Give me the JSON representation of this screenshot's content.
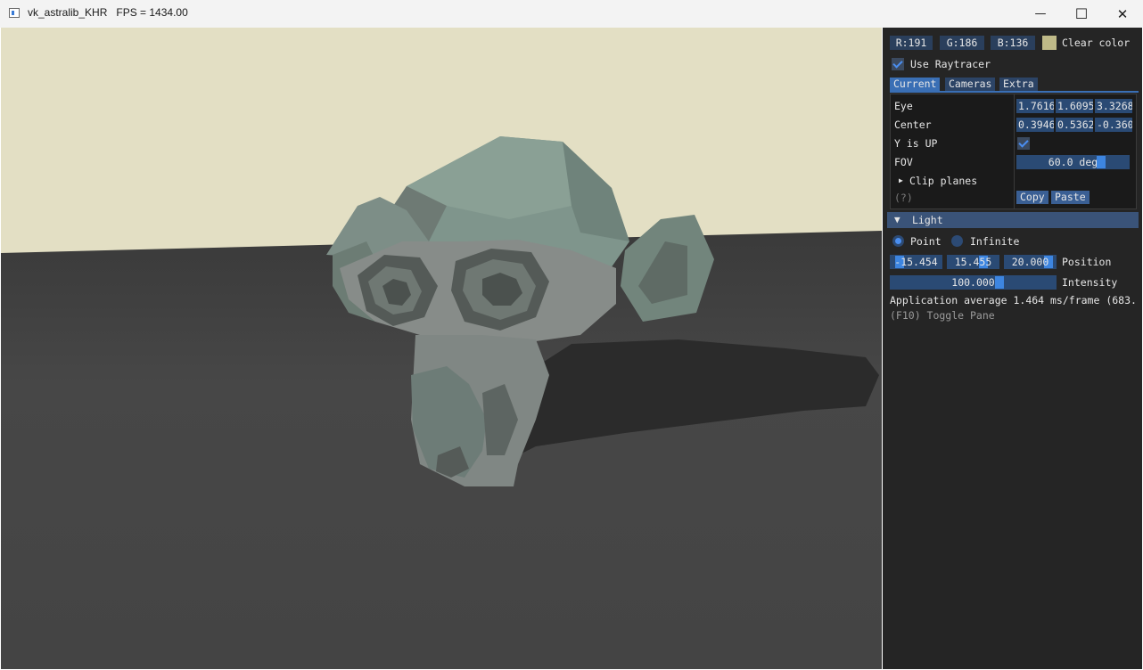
{
  "window": {
    "title": "vk_astralib_KHR   FPS = 1434.00",
    "minimize_glyph": "—",
    "maximize_glyph": "☐",
    "close_glyph": "✕"
  },
  "scene": {
    "sky_color": "#e3dfc4",
    "floor_color": "#464646",
    "mesh_name": "monkey"
  },
  "panel": {
    "clear_color": {
      "r_label": "R:191",
      "g_label": "G:186",
      "b_label": "B:136",
      "swatch": "#bfba88",
      "label": "Clear color"
    },
    "use_raytracer": {
      "label": "Use Raytracer",
      "checked": true
    },
    "tabs": [
      "Current",
      "Cameras",
      "Extra"
    ],
    "camera": {
      "eye_label": "Eye",
      "eye": [
        "1.7616",
        "1.6095",
        "3.3268"
      ],
      "center_label": "Center",
      "center": [
        "0.3946",
        "0.5362",
        "-0.360"
      ],
      "y_up_label": "Y is UP",
      "y_up": true,
      "fov_label": "FOV",
      "fov_value": "60.0 deg",
      "clip_label": "Clip planes",
      "help": "(?)",
      "copy_label": "Copy",
      "paste_label": "Paste"
    },
    "light": {
      "header": "Light",
      "point_label": "Point",
      "infinite_label": "Infinite",
      "selected": "Point",
      "position": [
        "-15.454",
        "15.455",
        "20.000"
      ],
      "position_label": "Position",
      "intensity": "100.000",
      "intensity_label": "Intensity"
    },
    "stats": "Application average 1.464 ms/frame (683.",
    "toggle_hint": "(F10) Toggle Pane"
  }
}
